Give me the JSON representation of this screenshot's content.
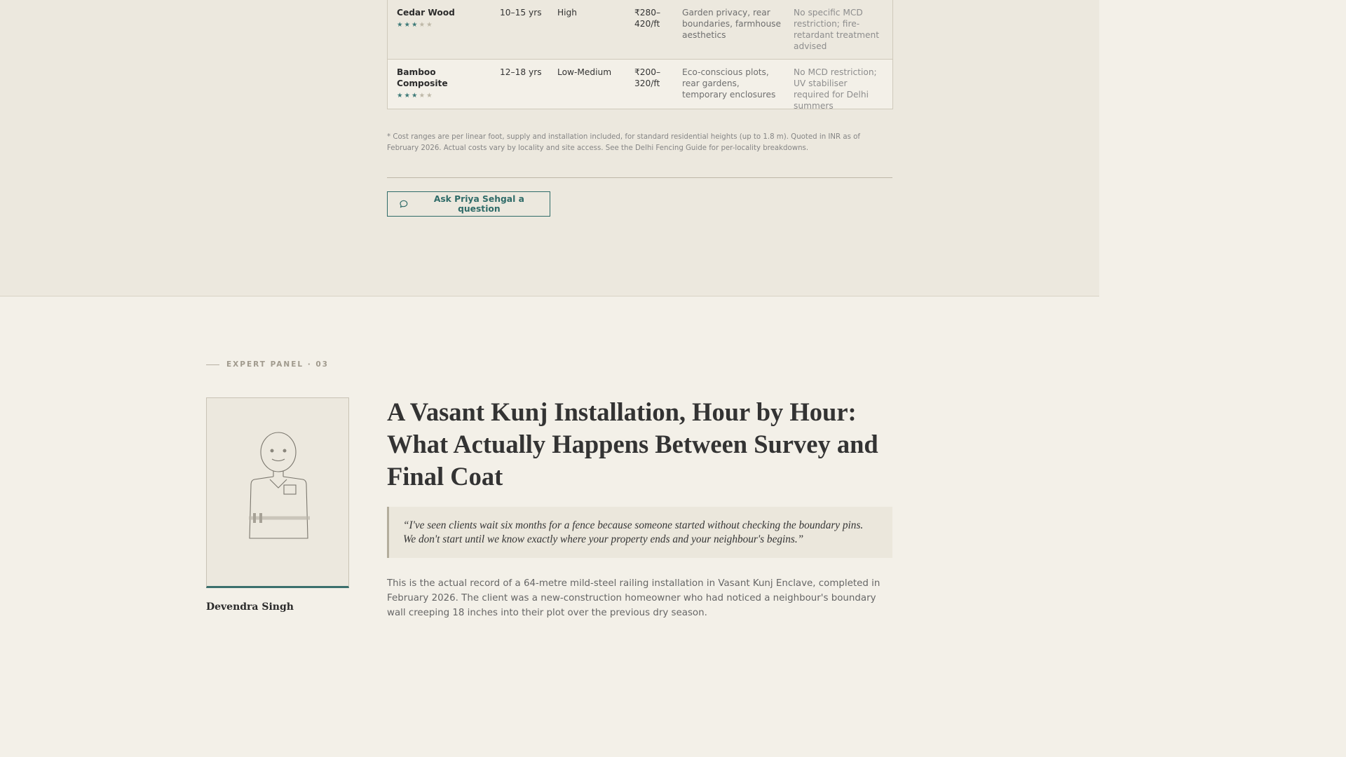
{
  "table": {
    "rows": [
      {
        "name": "Cedar Wood",
        "rating": "★★★",
        "rating_empty": "★★",
        "lifespan": "10–15 yrs",
        "maintenance": "High",
        "cost": "₹280–420/ft",
        "best_for": "Garden privacy, rear boundaries, farmhouse aesthetics",
        "regulation": "No specific MCD restriction; fire-retardant treatment advised"
      },
      {
        "name": "Bamboo Composite",
        "rating": "★★★",
        "rating_empty": "★★",
        "lifespan": "12–18 yrs",
        "maintenance": "Low-Medium",
        "cost": "₹200–320/ft",
        "best_for": "Eco-conscious plots, rear gardens, temporary enclosures",
        "regulation": "No MCD restriction; UV stabiliser required for Delhi summers"
      }
    ],
    "footnote": "* Cost ranges are per linear foot, supply and installation included, for standard residential heights (up to 1.8 m). Quoted in INR as of February 2026. Actual costs vary by locality and site access. See the Delhi Fencing Guide for per-locality breakdowns."
  },
  "ask_button": {
    "label": "Ask Priya Sehgal a question",
    "icon": "chat-bubble-icon"
  },
  "panel": {
    "eyebrow": "EXPERT PANEL · 03",
    "expert_name": "Devendra Singh",
    "headline": "A Vasant Kunj Installation, Hour by Hour: What Actually Happens Between Survey and Final Coat",
    "quote": "“I've seen clients wait six months for a fence because someone started without checking the boundary pins. We don't start until we know exactly where your property ends and your neighbour's begins.”",
    "body": "This is the actual record of a 64-metre mild-steel railing installation in Vasant Kunj Enclave, completed in February 2026. The client was a new-construction homeowner who had noticed a neighbour's boundary wall creeping 18 inches into their plot over the previous dry season."
  },
  "colors": {
    "accent": "#2f6b68",
    "band_bg": "#ece8de",
    "page_bg": "#f3f0e8"
  }
}
